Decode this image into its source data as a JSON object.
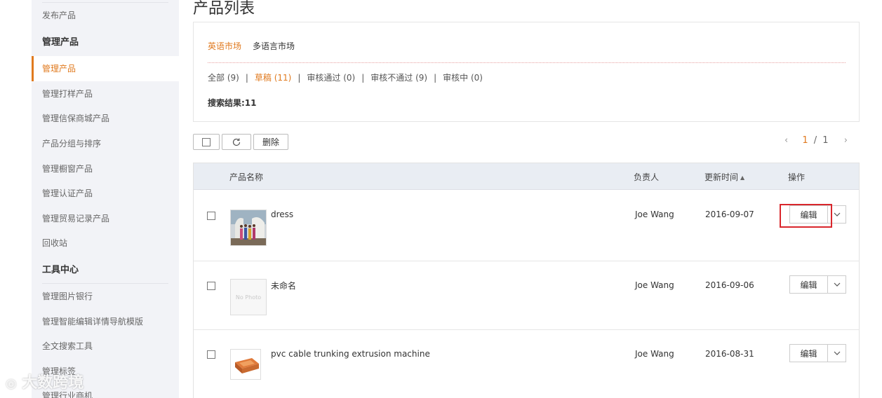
{
  "sidebar": {
    "items": [
      {
        "label": "发布产品"
      },
      {
        "label": "管理产品",
        "section_head": true
      },
      {
        "label": "管理产品",
        "active": true
      },
      {
        "label": "管理打样产品"
      },
      {
        "label": "管理信保商城产品"
      },
      {
        "label": "产品分组与排序"
      },
      {
        "label": "管理橱窗产品"
      },
      {
        "label": "管理认证产品"
      },
      {
        "label": "管理贸易记录产品"
      },
      {
        "label": "回收站"
      },
      {
        "label": "工具中心",
        "section_head": true
      },
      {
        "label": "管理图片银行"
      },
      {
        "label": "管理智能编辑详情导航模版"
      },
      {
        "label": "全文搜索工具"
      },
      {
        "label": "管理标签"
      },
      {
        "label": "管理行业商机"
      }
    ]
  },
  "page": {
    "title": "产品列表"
  },
  "markets": [
    {
      "label": "英语市场",
      "active": true
    },
    {
      "label": "多语言市场"
    }
  ],
  "statuses": [
    {
      "label": "全部 (9)"
    },
    {
      "label": "草稿 (11)",
      "active": true
    },
    {
      "label": "审核通过 (0)"
    },
    {
      "label": "审核不通过 (9)"
    },
    {
      "label": "审核中 (0)"
    }
  ],
  "status_separator": "|",
  "search_result": "搜索结果:11",
  "toolbar": {
    "delete_label": "删除"
  },
  "pager": {
    "current": "1",
    "separator": "/",
    "total": "1"
  },
  "table": {
    "headers": {
      "name": "产品名称",
      "owner": "负责人",
      "updated": "更新时间",
      "action": "操作"
    },
    "rows": [
      {
        "name": "dress",
        "owner": "Joe Wang",
        "date": "2016-09-07",
        "edit": "编辑"
      },
      {
        "name": "未命名",
        "owner": "Joe Wang",
        "date": "2016-09-06",
        "edit": "编辑",
        "no_photo": "No Photo"
      },
      {
        "name": "pvc cable trunking extrusion machine",
        "owner": "Joe Wang",
        "date": "2016-08-31",
        "edit": "编辑"
      }
    ]
  },
  "watermark": "大数跨境",
  "colors": {
    "accent": "#e07a1f",
    "highlight": "#d9262c",
    "sidebar_bg": "#f2f3f7",
    "header_bg": "#e9edf3"
  }
}
